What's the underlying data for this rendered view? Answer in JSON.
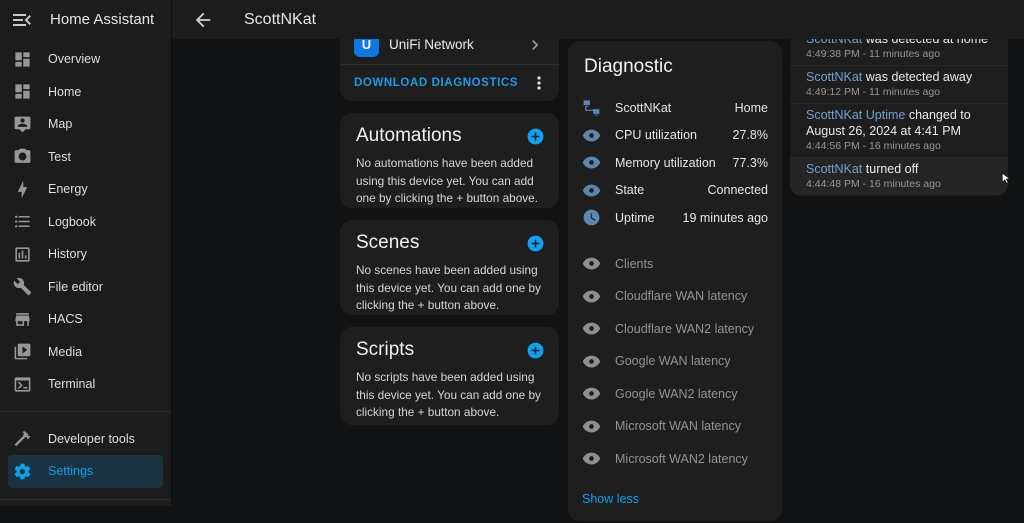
{
  "app": {
    "sidebar_title": "Home Assistant"
  },
  "header": {
    "title": "ScottNKat"
  },
  "sidebar": {
    "items": [
      {
        "label": "Overview",
        "icon": "view-dashboard"
      },
      {
        "label": "Home",
        "icon": "view-dashboard"
      },
      {
        "label": "Map",
        "icon": "tooltip-account"
      },
      {
        "label": "Test",
        "icon": "camera"
      },
      {
        "label": "Energy",
        "icon": "lightning-bolt"
      },
      {
        "label": "Logbook",
        "icon": "format-list-bulleted"
      },
      {
        "label": "History",
        "icon": "chart-box"
      },
      {
        "label": "File editor",
        "icon": "wrench"
      },
      {
        "label": "HACS",
        "icon": "storefront"
      },
      {
        "label": "Media",
        "icon": "play-box-multiple"
      },
      {
        "label": "Terminal",
        "icon": "console"
      },
      {
        "label": "Developer tools",
        "icon": "hammer"
      },
      {
        "label": "Settings",
        "icon": "cog",
        "active": true
      }
    ]
  },
  "info_card": {
    "integration_name": "UniFi Network",
    "download_label": "DOWNLOAD DIAGNOSTICS"
  },
  "cards": [
    {
      "title": "Automations",
      "body": "No automations have been added using this device yet. You can add one by clicking the + button above."
    },
    {
      "title": "Scenes",
      "body": "No scenes have been added using this device yet. You can add one by clicking the + button above."
    },
    {
      "title": "Scripts",
      "body": "No scripts have been added using this device yet. You can add one by clicking the + button above."
    }
  ],
  "diagnostic": {
    "title": "Diagnostic",
    "entities": [
      {
        "icon": "lan-connect",
        "name": "ScottNKat",
        "value": "Home"
      },
      {
        "icon": "eye",
        "name": "CPU utilization",
        "value": "27.8%"
      },
      {
        "icon": "eye",
        "name": "Memory utilization",
        "value": "77.3%"
      },
      {
        "icon": "eye",
        "name": "State",
        "value": "Connected"
      },
      {
        "icon": "clock",
        "name": "Uptime",
        "value": "19 minutes ago"
      }
    ],
    "disabled_entities": [
      {
        "icon": "eye",
        "name": "Clients"
      },
      {
        "icon": "eye",
        "name": "Cloudflare WAN latency"
      },
      {
        "icon": "eye",
        "name": "Cloudflare WAN2 latency"
      },
      {
        "icon": "eye",
        "name": "Google WAN latency"
      },
      {
        "icon": "eye",
        "name": "Google WAN2 latency"
      },
      {
        "icon": "eye",
        "name": "Microsoft WAN latency"
      },
      {
        "icon": "eye",
        "name": "Microsoft WAN2 latency"
      }
    ],
    "show_less_label": "Show less"
  },
  "logbook": {
    "entries": [
      {
        "entity": "ScottNKat",
        "message": "was detected at home",
        "time": "4:49:38 PM - 11 minutes ago"
      },
      {
        "entity": "ScottNKat",
        "message": "was detected away",
        "time": "4:49:12 PM - 11 minutes ago"
      },
      {
        "entity": "ScottNKat Uptime",
        "message": "changed to August 26, 2024 at 4:41 PM",
        "time": "4:44:56 PM - 16 minutes ago"
      },
      {
        "entity": "ScottNKat",
        "message": "turned off",
        "time": "4:44:48 PM - 16 minutes ago"
      }
    ]
  },
  "colors": {
    "accent": "#03a9f4",
    "card_background": "#1e1e1e",
    "page_background": "#111214",
    "entity_link": "#71a2ce",
    "state_icon": "#5b87b0"
  }
}
